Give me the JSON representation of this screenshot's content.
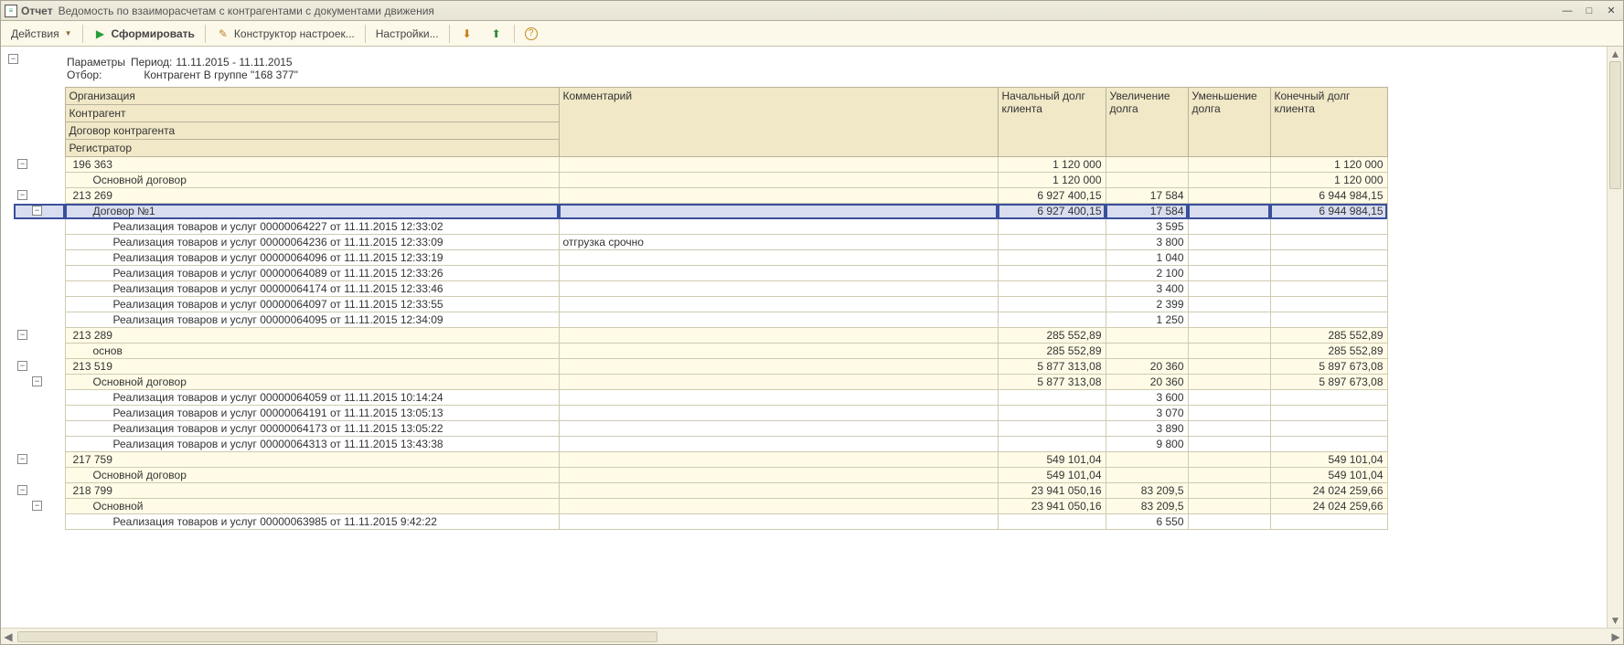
{
  "window": {
    "prefix": "Отчет",
    "title": "Ведомость по взаиморасчетам с контрагентами с документами движения"
  },
  "toolbar": {
    "actions": "Действия",
    "run": "Сформировать",
    "constructor": "Конструктор настроек...",
    "settings": "Настройки..."
  },
  "params": {
    "label": "Параметры",
    "period_label": "Период:",
    "period_value": "11.11.2015 - 11.11.2015",
    "filter_label": "Отбор:",
    "filter_value": "Контрагент В группе \"168 377\""
  },
  "headers": {
    "org": "Организация",
    "contr": "Контрагент",
    "contract": "Договор контрагента",
    "reg": "Регистратор",
    "comment": "Комментарий",
    "c1": "Начальный долг клиента",
    "c2": "Увеличение долга",
    "c3": "Уменьшение долга",
    "c4": "Конечный долг клиента"
  },
  "rows": [
    {
      "lvl": 1,
      "tog": "-",
      "name": "196 363",
      "comm": "",
      "c1": "1 120 000",
      "c2": "",
      "c3": "",
      "c4": "1 120 000"
    },
    {
      "lvl": 2,
      "tog": "",
      "name": "Основной договор",
      "comm": "",
      "c1": "1 120 000",
      "c2": "",
      "c3": "",
      "c4": "1 120 000"
    },
    {
      "lvl": 1,
      "tog": "-",
      "name": "213 269",
      "comm": "",
      "c1": "6 927 400,15",
      "c2": "17 584",
      "c3": "",
      "c4": "6 944 984,15"
    },
    {
      "lvl": 2,
      "tog": "-",
      "name": "Договор №1",
      "comm": "",
      "c1": "6 927 400,15",
      "c2": "17 584",
      "c3": "",
      "c4": "6 944 984,15",
      "sel": true
    },
    {
      "lvl": 3,
      "tog": "",
      "name": "Реализация товаров и услуг 00000064227 от 11.11.2015 12:33:02",
      "comm": "",
      "c1": "",
      "c2": "3 595",
      "c3": "",
      "c4": ""
    },
    {
      "lvl": 3,
      "tog": "",
      "name": "Реализация товаров и услуг 00000064236 от 11.11.2015 12:33:09",
      "comm": "отгрузка срочно",
      "c1": "",
      "c2": "3 800",
      "c3": "",
      "c4": ""
    },
    {
      "lvl": 3,
      "tog": "",
      "name": "Реализация товаров и услуг 00000064096 от 11.11.2015 12:33:19",
      "comm": "",
      "c1": "",
      "c2": "1 040",
      "c3": "",
      "c4": ""
    },
    {
      "lvl": 3,
      "tog": "",
      "name": "Реализация товаров и услуг 00000064089 от 11.11.2015 12:33:26",
      "comm": "",
      "c1": "",
      "c2": "2 100",
      "c3": "",
      "c4": ""
    },
    {
      "lvl": 3,
      "tog": "",
      "name": "Реализация товаров и услуг 00000064174 от 11.11.2015 12:33:46",
      "comm": "",
      "c1": "",
      "c2": "3 400",
      "c3": "",
      "c4": ""
    },
    {
      "lvl": 3,
      "tog": "",
      "name": "Реализация товаров и услуг 00000064097 от 11.11.2015 12:33:55",
      "comm": "",
      "c1": "",
      "c2": "2 399",
      "c3": "",
      "c4": ""
    },
    {
      "lvl": 3,
      "tog": "",
      "name": "Реализация товаров и услуг 00000064095 от 11.11.2015 12:34:09",
      "comm": "",
      "c1": "",
      "c2": "1 250",
      "c3": "",
      "c4": ""
    },
    {
      "lvl": 1,
      "tog": "-",
      "name": "213 289",
      "comm": "",
      "c1": "285 552,89",
      "c2": "",
      "c3": "",
      "c4": "285 552,89"
    },
    {
      "lvl": 2,
      "tog": "",
      "name": "основ",
      "comm": "",
      "c1": "285 552,89",
      "c2": "",
      "c3": "",
      "c4": "285 552,89"
    },
    {
      "lvl": 1,
      "tog": "-",
      "name": "213 519",
      "comm": "",
      "c1": "5 877 313,08",
      "c2": "20 360",
      "c3": "",
      "c4": "5 897 673,08"
    },
    {
      "lvl": 2,
      "tog": "-",
      "name": "Основной договор",
      "comm": "",
      "c1": "5 877 313,08",
      "c2": "20 360",
      "c3": "",
      "c4": "5 897 673,08"
    },
    {
      "lvl": 3,
      "tog": "",
      "name": "Реализация товаров и услуг 00000064059 от 11.11.2015 10:14:24",
      "comm": "",
      "c1": "",
      "c2": "3 600",
      "c3": "",
      "c4": ""
    },
    {
      "lvl": 3,
      "tog": "",
      "name": "Реализация товаров и услуг 00000064191 от 11.11.2015 13:05:13",
      "comm": "",
      "c1": "",
      "c2": "3 070",
      "c3": "",
      "c4": ""
    },
    {
      "lvl": 3,
      "tog": "",
      "name": "Реализация товаров и услуг 00000064173 от 11.11.2015 13:05:22",
      "comm": "",
      "c1": "",
      "c2": "3 890",
      "c3": "",
      "c4": ""
    },
    {
      "lvl": 3,
      "tog": "",
      "name": "Реализация товаров и услуг 00000064313 от 11.11.2015 13:43:38",
      "comm": "",
      "c1": "",
      "c2": "9 800",
      "c3": "",
      "c4": ""
    },
    {
      "lvl": 1,
      "tog": "-",
      "name": "217 759",
      "comm": "",
      "c1": "549 101,04",
      "c2": "",
      "c3": "",
      "c4": "549 101,04"
    },
    {
      "lvl": 2,
      "tog": "",
      "name": "Основной договор",
      "comm": "",
      "c1": "549 101,04",
      "c2": "",
      "c3": "",
      "c4": "549 101,04"
    },
    {
      "lvl": 1,
      "tog": "-",
      "name": "218 799",
      "comm": "",
      "c1": "23 941 050,16",
      "c2": "83 209,5",
      "c3": "",
      "c4": "24 024 259,66"
    },
    {
      "lvl": 2,
      "tog": "-",
      "name": "Основной",
      "comm": "",
      "c1": "23 941 050,16",
      "c2": "83 209,5",
      "c3": "",
      "c4": "24 024 259,66"
    },
    {
      "lvl": 3,
      "tog": "",
      "name": "Реализация товаров и услуг 00000063985 от 11.11.2015 9:42:22",
      "comm": "",
      "c1": "",
      "c2": "6 550",
      "c3": "",
      "c4": ""
    }
  ]
}
